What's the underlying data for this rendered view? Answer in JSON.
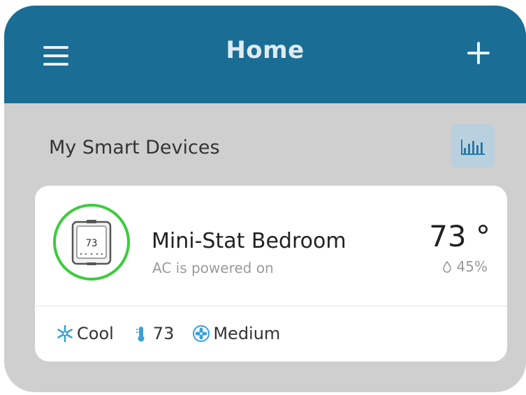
{
  "header": {
    "title": "Home",
    "menu_icon": "hamburger-menu-icon",
    "add_icon": "plus-icon",
    "bg_color": "#1a6e96"
  },
  "section": {
    "title": "My Smart Devices",
    "stats_icon": "bar-chart-icon"
  },
  "device": {
    "name": "Mini-Stat Bedroom",
    "status": "AC is powered on",
    "temperature": "73 °",
    "humidity": "45%",
    "icon": "thermostat-device-icon",
    "ring_color": "#3ccc3c",
    "display_reading": "73",
    "footer": {
      "mode": "Cool",
      "mode_icon": "snowflake-icon",
      "setpoint": "73",
      "setpoint_icon": "thermometer-icon",
      "fan": "Medium",
      "fan_icon": "fan-icon"
    }
  }
}
